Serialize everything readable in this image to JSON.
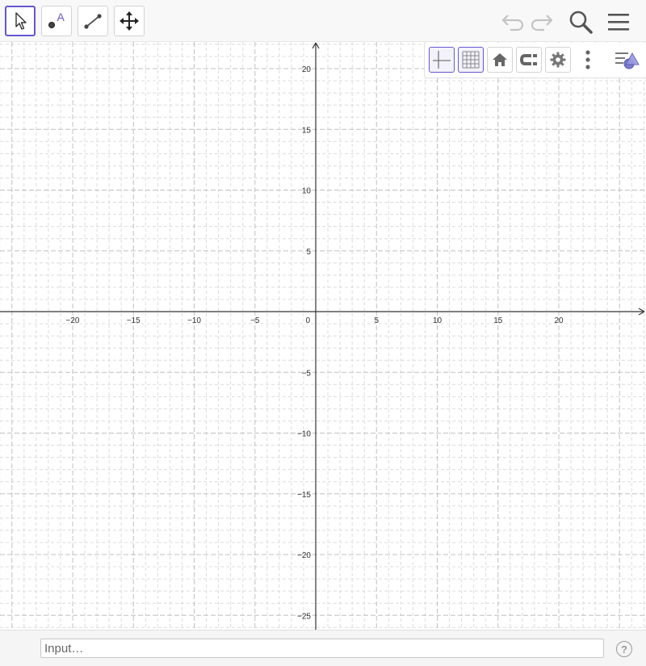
{
  "toolbar": {
    "tools": [
      {
        "name": "move-tool",
        "icon": "arrow-cursor-icon",
        "selected": true
      },
      {
        "name": "point-tool",
        "icon": "point-icon",
        "label": "A"
      },
      {
        "name": "segment-tool",
        "icon": "segment-icon"
      },
      {
        "name": "move-graphics-view-tool",
        "icon": "move-arrows-icon"
      }
    ],
    "right_icons": [
      "undo-icon",
      "redo-icon",
      "search-icon",
      "menu-icon"
    ]
  },
  "stylebar": {
    "buttons": [
      {
        "name": "show-axes",
        "icon": "axes-icon",
        "active": true
      },
      {
        "name": "show-grid",
        "icon": "grid-icon",
        "active": true
      },
      {
        "name": "standard-view",
        "icon": "home-icon"
      },
      {
        "name": "point-capturing",
        "icon": "magnet-icon"
      },
      {
        "name": "graphics-settings",
        "icon": "gear-icon"
      },
      {
        "name": "more-options",
        "icon": "more-vertical-icon"
      },
      {
        "name": "toggle-style-bar",
        "icon": "style-bar-toggle-icon"
      }
    ]
  },
  "graph": {
    "grid": true,
    "axes": true,
    "x_range": [
      -22,
      22.5
    ],
    "y_range": [
      -26,
      22
    ],
    "x_ticks": [
      "−20",
      "−15",
      "−10",
      "−5",
      "0",
      "5",
      "10",
      "15",
      "20"
    ],
    "x_tick_values": [
      -20,
      -15,
      -10,
      -5,
      0,
      5,
      10,
      15,
      20
    ],
    "y_ticks": [
      "20",
      "15",
      "10",
      "5",
      "−5",
      "−10",
      "−15",
      "−20",
      "−25"
    ],
    "y_tick_values": [
      20,
      15,
      10,
      5,
      -5,
      -10,
      -15,
      -20,
      -25
    ],
    "colors": {
      "axis": "#333333",
      "grid_major": "#c0c0c0",
      "grid_minor": "#dcdcdc",
      "label": "#333333"
    }
  },
  "inputbar": {
    "placeholder": "Input…",
    "help_label": "?"
  },
  "colors": {
    "accent": "#6557d2",
    "icon": "#666666"
  }
}
